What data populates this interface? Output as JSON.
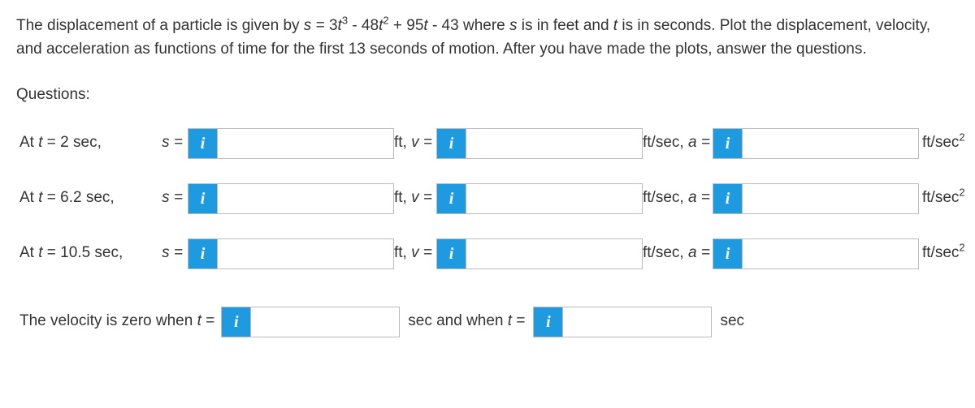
{
  "problem": {
    "pre": "The displacement of a particle is given by ",
    "equation_s": "s",
    "equation_eq": " = 3",
    "equation_t": "t",
    "equation_p1": "3",
    "equation_mid1": " - 48",
    "equation_p2": "2",
    "equation_mid2": " + 95",
    "equation_mid3": " - 43 where ",
    "s2": "s",
    "mid4": " is in feet and ",
    "t2": "t",
    "post": " is in seconds. Plot the displacement, velocity, and acceleration as functions of time for the first 13 seconds of motion. After you have made the plots, answer the questions."
  },
  "labels": {
    "questions": "Questions:",
    "info_glyph": "i",
    "s_eq": "s =",
    "v_eq": "v =",
    "a_eq": "a =",
    "ft_v_prefix": "ft, ",
    "ftsec_a_prefix": "ft/sec, ",
    "ftsec2": "ft/sec",
    "sec": "sec"
  },
  "rows": [
    {
      "time_pre": "At ",
      "time_t": "t",
      "time_post": " = 2 sec,"
    },
    {
      "time_pre": "At ",
      "time_t": "t",
      "time_post": " = 6.2 sec,"
    },
    {
      "time_pre": "At ",
      "time_t": "t",
      "time_post": " = 10.5 sec,"
    }
  ],
  "zero_line": {
    "pre": "The velocity is zero when ",
    "t": "t",
    "eq": " = ",
    "mid_sec": "sec and when ",
    "t2": "t",
    "eq2": " = "
  },
  "inputs": {
    "r0_s": "",
    "r0_v": "",
    "r0_a": "",
    "r1_s": "",
    "r1_v": "",
    "r1_a": "",
    "r2_s": "",
    "r2_v": "",
    "r2_a": "",
    "z1": "",
    "z2": ""
  }
}
